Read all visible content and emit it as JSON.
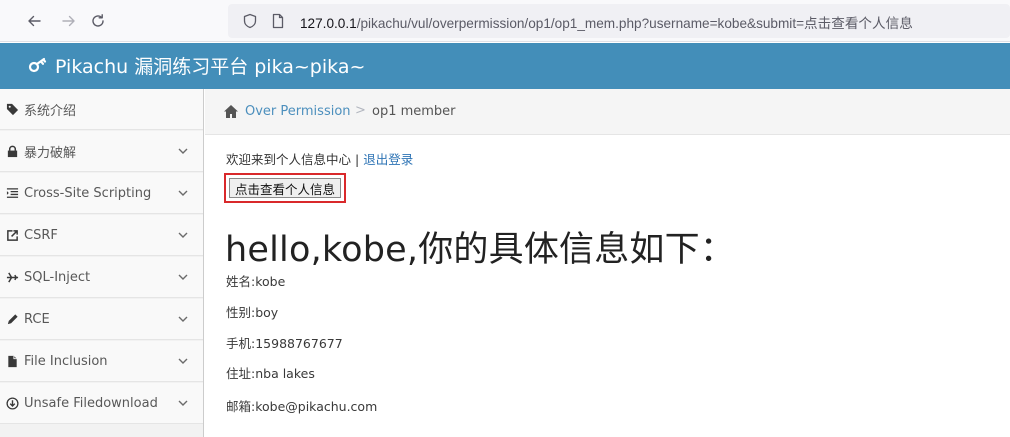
{
  "browser": {
    "url_host": "127.0.0.1",
    "url_path": "/pikachu/vul/overpermission/op1/op1_mem.php?username=kobe&submit=点击查看个人信息"
  },
  "navbar": {
    "brand": "Pikachu 漏洞练习平台 pika~pika~"
  },
  "sidebar": {
    "items": [
      {
        "label": "系统介绍",
        "icon": "tag-icon",
        "has_chevron": false
      },
      {
        "label": "暴力破解",
        "icon": "lock-icon",
        "has_chevron": true
      },
      {
        "label": "Cross-Site Scripting",
        "icon": "list-indent-icon",
        "has_chevron": true
      },
      {
        "label": "CSRF",
        "icon": "share-icon",
        "has_chevron": true
      },
      {
        "label": "SQL-Inject",
        "icon": "plane-icon",
        "has_chevron": true
      },
      {
        "label": "RCE",
        "icon": "pencil-icon",
        "has_chevron": true
      },
      {
        "label": "File Inclusion",
        "icon": "file-icon",
        "has_chevron": true
      },
      {
        "label": "Unsafe Filedownload",
        "icon": "download-circle-icon",
        "has_chevron": true
      }
    ]
  },
  "breadcrumb": {
    "link": "Over Permission",
    "separator": ">",
    "current": "op1 member"
  },
  "main": {
    "welcome_text": "欢迎来到个人信息中心",
    "welcome_sep": "|",
    "logout_link": "退出登录",
    "view_button": "点击查看个人信息",
    "hello_heading": "hello,kobe,你的具体信息如下：",
    "info": [
      "姓名:kobe",
      "性别:boy",
      "手机:15988767677",
      "住址:nba lakes",
      "邮箱:kobe@pikachu.com"
    ]
  },
  "colors": {
    "navbar": "#438eb9",
    "link": "#4c8fbd",
    "highlight_border": "#d9292b"
  }
}
